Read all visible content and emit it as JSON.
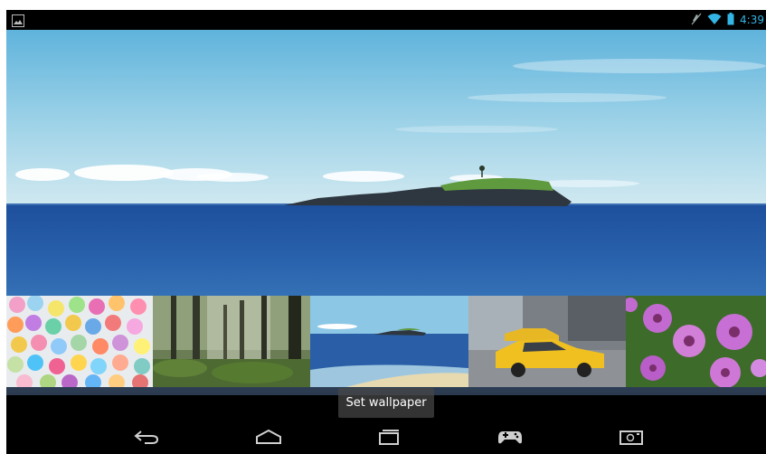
{
  "statusbar": {
    "time": "4:39",
    "icons": [
      "gallery-icon",
      "mute-icon",
      "wifi-icon",
      "battery-icon"
    ]
  },
  "wallpaper": {
    "subject": "island-seascape"
  },
  "thumbnails": [
    {
      "name": "balloons"
    },
    {
      "name": "forest"
    },
    {
      "name": "island-seascape"
    },
    {
      "name": "yellow-taxi"
    },
    {
      "name": "purple-flowers"
    }
  ],
  "actions": {
    "set_wallpaper_label": "Set wallpaper"
  },
  "navbar": {
    "buttons": [
      "back-icon",
      "home-icon",
      "recents-icon",
      "games-icon",
      "screenshot-icon"
    ]
  },
  "colors": {
    "accent": "#33b5e5",
    "sea": "#1f4f9a",
    "sky": "#7fc1df"
  }
}
